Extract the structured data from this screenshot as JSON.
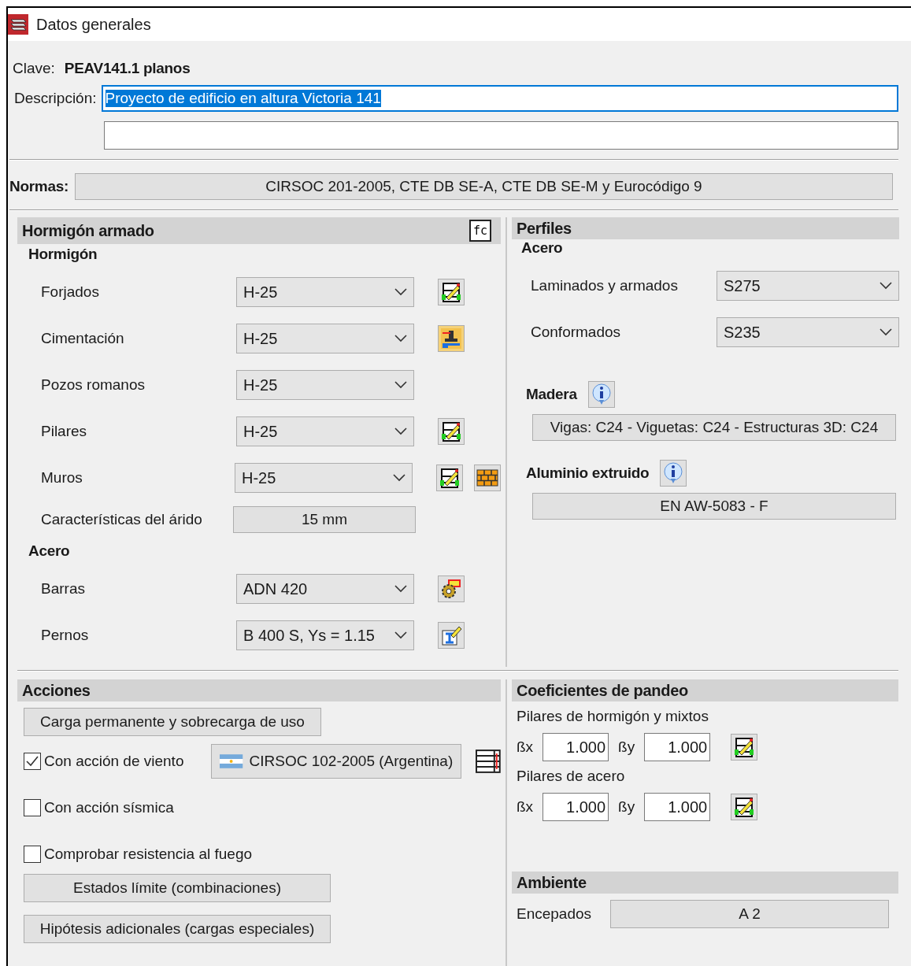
{
  "window": {
    "title": "Datos generales"
  },
  "clave": {
    "label": "Clave:",
    "value": "PEAV141.1 planos"
  },
  "descripcion": {
    "label": "Descripción:",
    "value": "Proyecto de edificio en altura Victoria 141",
    "selected": true
  },
  "normas": {
    "label": "Normas:",
    "value": "CIRSOC 201-2005, CTE DB SE-A, CTE DB SE-M y Eurocódigo 9"
  },
  "hormigon_armado": {
    "title": "Hormigón armado",
    "formula_button": "fc",
    "hormigon": {
      "title": "Hormigón",
      "rows": [
        {
          "label": "Forjados",
          "value": "H-25",
          "tools": [
            {
              "kind": "edit"
            }
          ]
        },
        {
          "label": "Cimentación",
          "value": "H-25",
          "tools": [
            {
              "kind": "foundation"
            }
          ]
        },
        {
          "label": "Pozos romanos",
          "value": "H-25"
        },
        {
          "label": "Pilares",
          "value": "H-25",
          "tools": [
            {
              "kind": "edit"
            }
          ]
        },
        {
          "label": "Muros",
          "value": "H-25",
          "tools": [
            {
              "kind": "edit"
            },
            {
              "kind": "wall"
            }
          ]
        }
      ]
    },
    "arido": {
      "label": "Características del árido",
      "value": "15 mm"
    },
    "acero": {
      "title": "Acero",
      "rows": [
        {
          "label": "Barras",
          "value": "ADN 420",
          "tools": [
            {
              "kind": "gear"
            }
          ]
        },
        {
          "label": "Pernos",
          "value": "B 400 S, Ys = 1.15",
          "tools": [
            {
              "kind": "bolt"
            }
          ]
        }
      ]
    }
  },
  "perfiles": {
    "title": "Perfiles",
    "acero": {
      "title": "Acero",
      "rows": [
        {
          "label": "Laminados y armados",
          "value": "S275"
        },
        {
          "label": "Conformados",
          "value": "S235"
        }
      ]
    },
    "madera": {
      "title": "Madera",
      "value": "Vigas: C24 - Viguetas: C24 - Estructuras 3D: C24"
    },
    "aluminio": {
      "title": "Aluminio extruido",
      "value": "EN AW-5083 - F"
    }
  },
  "acciones": {
    "title": "Acciones",
    "load_button": "Carga permanente y sobrecarga de uso",
    "options": [
      {
        "label": "Con acción de viento",
        "checked": true,
        "code_button": "CIRSOC 102-2005 (Argentina)"
      },
      {
        "label": "Con acción sísmica",
        "checked": false
      },
      {
        "label": "Comprobar resistencia al fuego",
        "checked": false
      }
    ],
    "buttons": [
      "Estados límite (combinaciones)",
      "Hipótesis adicionales (cargas especiales)"
    ]
  },
  "pandeo": {
    "title": "Coeficientes de pandeo",
    "groups": [
      {
        "title": "Pilares de hormigón y mixtos",
        "bx_label": "ßx",
        "bx": "1.000",
        "by_label": "ßy",
        "by": "1.000"
      },
      {
        "title": "Pilares de acero",
        "bx_label": "ßx",
        "bx": "1.000",
        "by_label": "ßy",
        "by": "1.000"
      }
    ]
  },
  "ambiente": {
    "title": "Ambiente",
    "label": "Encepados",
    "value": "A 2"
  }
}
